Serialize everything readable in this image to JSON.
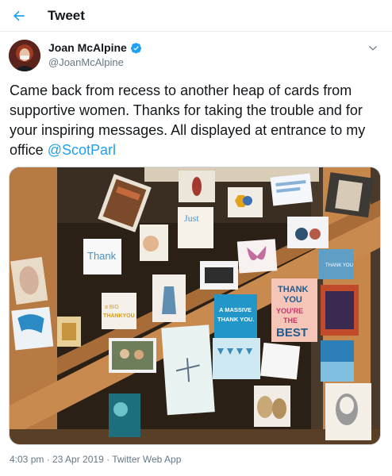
{
  "header": {
    "title": "Tweet",
    "back_icon": "back-arrow-icon",
    "accent_color": "#1da1f2"
  },
  "author": {
    "display_name": "Joan McAlpine",
    "handle": "@JoanMcAlpine",
    "verified": true,
    "verified_color": "#1da1f2"
  },
  "tweet": {
    "text_before": "Came back from recess to another heap of cards from supportive women. Thanks for taking the trouble and for your inspiring messages. All displayed at entrance to my office ",
    "mention": "@ScotParl"
  },
  "media": {
    "card_texts": {
      "just": "Just",
      "thank": "Thank",
      "thank_you_small": "THANK YOU",
      "a_big_thank_you_1": "a BIG",
      "a_big_thank_you_2": "THANKYOU",
      "massive_1": "A MASSIVE",
      "massive_2": "THANK YOU.",
      "best_1": "THANK",
      "best_2": "YOU",
      "best_3": "YOU'RE",
      "best_4": "THE",
      "best_5": "BEST"
    }
  },
  "meta": {
    "time": "4:03 pm",
    "separator1": " · ",
    "date": "23 Apr 2019",
    "separator2": " · ",
    "source": "Twitter Web App"
  }
}
